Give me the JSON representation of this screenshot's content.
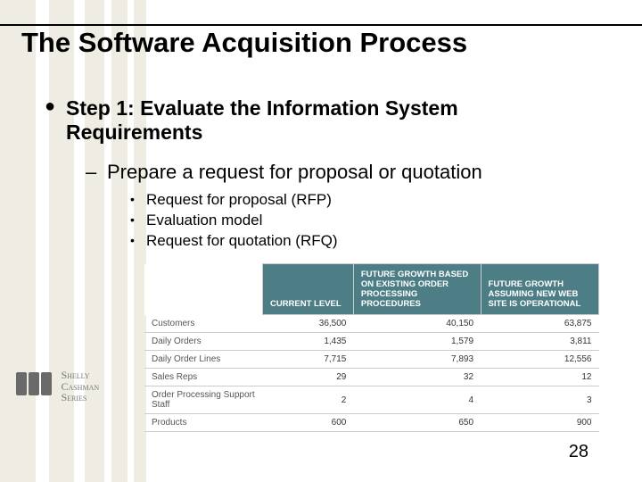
{
  "title": "The Software Acquisition Process",
  "step": {
    "heading": "Step 1: Evaluate the Information System Requirements",
    "sub": "Prepare a request for proposal or quotation",
    "items": [
      "Request for proposal (RFP)",
      "Evaluation model",
      "Request for quotation (RFQ)"
    ]
  },
  "chart_data": {
    "type": "table",
    "columns": [
      "",
      "CURRENT LEVEL",
      "FUTURE GROWTH BASED ON EXISTING ORDER PROCESSING PROCEDURES",
      "FUTURE GROWTH ASSUMING NEW WEB SITE IS OPERATIONAL"
    ],
    "rows": [
      {
        "label": "Customers",
        "values": [
          "36,500",
          "40,150",
          "63,875"
        ]
      },
      {
        "label": "Daily Orders",
        "values": [
          "1,435",
          "1,579",
          "3,811"
        ]
      },
      {
        "label": "Daily Order Lines",
        "values": [
          "7,715",
          "7,893",
          "12,556"
        ]
      },
      {
        "label": "Sales Reps",
        "values": [
          "29",
          "32",
          "12"
        ]
      },
      {
        "label": "Order Processing Support Staff",
        "values": [
          "2",
          "4",
          "3"
        ]
      },
      {
        "label": "Products",
        "values": [
          "600",
          "650",
          "900"
        ]
      }
    ]
  },
  "series_logo": {
    "line1": "Shelly",
    "line2": "Cashman",
    "line3": "Series"
  },
  "page_number": "28"
}
